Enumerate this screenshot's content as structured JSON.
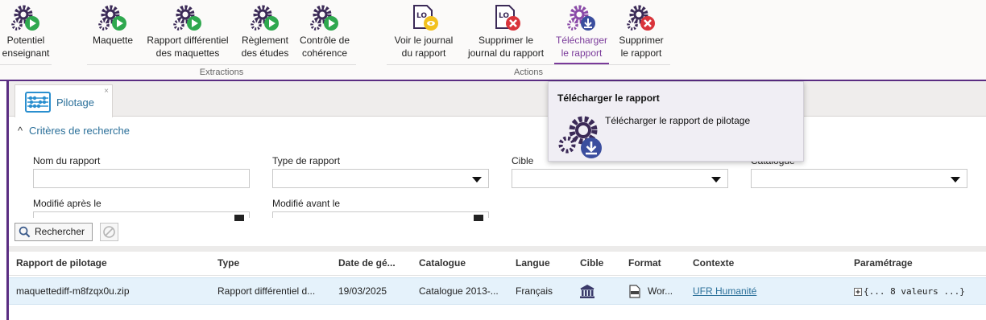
{
  "ribbon": {
    "buttons": [
      {
        "label": "Potentiel\nenseignant",
        "badge": "play"
      },
      {
        "label": "Maquette",
        "badge": "play"
      },
      {
        "label": "Rapport différentiel\ndes maquettes",
        "badge": "play"
      },
      {
        "label": "Règlement\ndes études",
        "badge": "play"
      },
      {
        "label": "Contrôle de\ncohérence",
        "badge": "play"
      },
      {
        "label": "Voir le journal\ndu rapport",
        "badge": "view"
      },
      {
        "label": "Supprimer le\njournal du rapport",
        "badge": "delete"
      },
      {
        "label": "Télécharger\nle rapport",
        "badge": "download",
        "active": true
      },
      {
        "label": "Supprimer\nle rapport",
        "badge": "delete"
      }
    ],
    "groups": {
      "extractions": "Extractions",
      "actions": "Actions"
    }
  },
  "tab": {
    "label": "Pilotage",
    "close": "×"
  },
  "criteria": {
    "toggle": "Critères de recherche",
    "chevron": "^",
    "fields": {
      "report_name": "Nom du rapport",
      "report_type": "Type de rapport",
      "target": "Cible",
      "catalog": "Catalogue",
      "modified_after": "Modifié après le",
      "modified_before": "Modifié avant le"
    },
    "values": {
      "report_name": "",
      "report_type": "",
      "target": "",
      "catalog": "",
      "modified_after": "",
      "modified_before": ""
    }
  },
  "actions": {
    "search": "Rechercher"
  },
  "grid": {
    "columns": [
      "Rapport de pilotage",
      "Type",
      "Date de gé...",
      "Catalogue",
      "Langue",
      "Cible",
      "Format",
      "Contexte",
      "Paramétrage"
    ],
    "rows": [
      {
        "report": "maquettediff-m8fzqx0u.zip",
        "type": "Rapport différentiel d...",
        "date": "19/03/2025",
        "catalog": "Catalogue 2013-...",
        "language": "Français",
        "target_icon": "institution-icon",
        "format": "Wor...",
        "context": "UFR Humanité",
        "params": "{... 8 valeurs ...}"
      }
    ]
  },
  "tooltip": {
    "title": "Télécharger le rapport",
    "text": "Télécharger le rapport de pilotage"
  },
  "colors": {
    "accent": "#5a2d82",
    "link": "#2a6f99",
    "play": "#2fa84f",
    "delete": "#d9343b",
    "download": "#3b4e9e",
    "view": "#f2c11e"
  }
}
